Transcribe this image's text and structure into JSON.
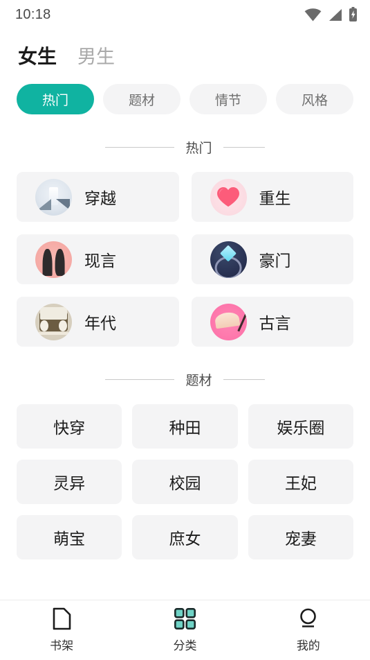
{
  "status_bar": {
    "time": "10:18",
    "icons": [
      "wifi-icon",
      "cellular-signal-icon",
      "battery-charging-icon"
    ]
  },
  "theme": {
    "accent": "#10b3a1",
    "card_bg": "#f4f4f5",
    "text": "#1b1b1b",
    "muted_text": "#a9a9a9"
  },
  "gender_tabs": [
    {
      "label": "女生",
      "active": true
    },
    {
      "label": "男生",
      "active": false
    }
  ],
  "filter_chips": [
    {
      "label": "热门",
      "active": true
    },
    {
      "label": "题材",
      "active": false
    },
    {
      "label": "情节",
      "active": false
    },
    {
      "label": "风格",
      "active": false
    }
  ],
  "sections": [
    {
      "title": "热门",
      "layout": "icon-cards-2col",
      "items": [
        {
          "label": "穿越",
          "icon": "portal-icon"
        },
        {
          "label": "重生",
          "icon": "heart-icon"
        },
        {
          "label": "现言",
          "icon": "couple-icon"
        },
        {
          "label": "豪门",
          "icon": "diamond-ring-icon"
        },
        {
          "label": "年代",
          "icon": "cassette-tape-icon"
        },
        {
          "label": "古言",
          "icon": "folding-fan-icon"
        }
      ]
    },
    {
      "title": "题材",
      "layout": "text-cards-3col",
      "items": [
        {
          "label": "快穿"
        },
        {
          "label": "种田"
        },
        {
          "label": "娱乐圈"
        },
        {
          "label": "灵异"
        },
        {
          "label": "校园"
        },
        {
          "label": "王妃"
        },
        {
          "label": "萌宝"
        },
        {
          "label": "庶女"
        },
        {
          "label": "宠妻"
        }
      ]
    }
  ],
  "bottom_nav": [
    {
      "label": "书架",
      "icon": "bookshelf-page-icon",
      "active": false
    },
    {
      "label": "分类",
      "icon": "grid-category-icon",
      "active": true
    },
    {
      "label": "我的",
      "icon": "person-icon",
      "active": false
    }
  ]
}
